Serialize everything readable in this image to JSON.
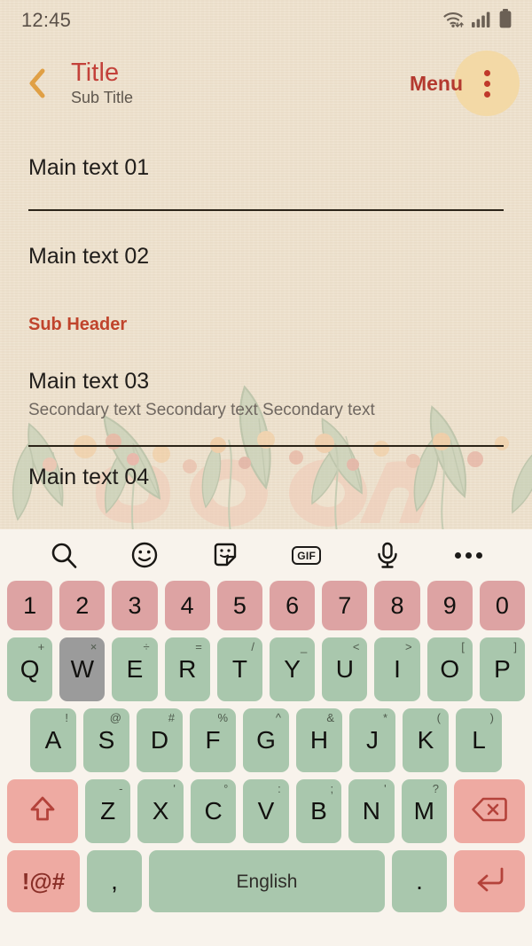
{
  "status_bar": {
    "time": "12:45",
    "icons": [
      "wifi-icon",
      "signal-icon",
      "battery-icon"
    ]
  },
  "app_bar": {
    "back_icon": "chevron-left-icon",
    "title": "Title",
    "subtitle": "Sub Title",
    "menu_label": "Menu",
    "overflow_icon": "more-vertical-icon",
    "accent_title_color": "#c3413a",
    "accent_menu_color": "#b4392f",
    "overflow_bg_color": "#f3d9a6"
  },
  "content": {
    "rows": [
      {
        "main": "Main text 01",
        "secondary": "",
        "divider_after": true
      },
      {
        "main": "Main text 02",
        "secondary": "",
        "divider_after": false
      }
    ],
    "sub_header": "Sub Header",
    "rows2": [
      {
        "main": "Main text 03",
        "secondary": "Secondary text Secondary text Secondary text",
        "divider_after": true
      },
      {
        "main": "Main text 04",
        "secondary": "",
        "divider_after": false
      }
    ],
    "sub_header_color": "#c0442c",
    "background_color": "#efe3d0"
  },
  "keyboard": {
    "toolbar": [
      {
        "name": "search-icon",
        "label": ""
      },
      {
        "name": "emoji-icon",
        "label": ""
      },
      {
        "name": "sticker-icon",
        "label": ""
      },
      {
        "name": "gif-icon",
        "label": "GIF"
      },
      {
        "name": "microphone-icon",
        "label": ""
      },
      {
        "name": "more-horizontal-icon",
        "label": ""
      }
    ],
    "number_row": [
      "1",
      "2",
      "3",
      "4",
      "5",
      "6",
      "7",
      "8",
      "9",
      "0"
    ],
    "row_q": [
      {
        "key": "Q",
        "sup": "+"
      },
      {
        "key": "W",
        "sup": "×",
        "pressed": true
      },
      {
        "key": "E",
        "sup": "÷"
      },
      {
        "key": "R",
        "sup": "="
      },
      {
        "key": "T",
        "sup": "/"
      },
      {
        "key": "Y",
        "sup": "_"
      },
      {
        "key": "U",
        "sup": "<"
      },
      {
        "key": "I",
        "sup": ">"
      },
      {
        "key": "O",
        "sup": "["
      },
      {
        "key": "P",
        "sup": "]"
      }
    ],
    "row_a": [
      {
        "key": "A",
        "sup": "!"
      },
      {
        "key": "S",
        "sup": "@"
      },
      {
        "key": "D",
        "sup": "#"
      },
      {
        "key": "F",
        "sup": "%"
      },
      {
        "key": "G",
        "sup": "^"
      },
      {
        "key": "H",
        "sup": "&"
      },
      {
        "key": "J",
        "sup": "*"
      },
      {
        "key": "K",
        "sup": "("
      },
      {
        "key": "L",
        "sup": ")"
      }
    ],
    "row_z": [
      {
        "key": "Z",
        "sup": "-"
      },
      {
        "key": "X",
        "sup": "'"
      },
      {
        "key": "C",
        "sup": "°"
      },
      {
        "key": "V",
        "sup": ":"
      },
      {
        "key": "B",
        "sup": ";"
      },
      {
        "key": "N",
        "sup": "'"
      },
      {
        "key": "M",
        "sup": "?"
      }
    ],
    "shift_icon": "shift-arrow-icon",
    "backspace_icon": "backspace-icon",
    "symbols_label": "!@#",
    "comma_label": ",",
    "space_label": "English",
    "period_label": ".",
    "enter_icon": "enter-arrow-icon",
    "colors": {
      "keyboard_bg": "#f8f3ec",
      "number_key": "#dda3a3",
      "letter_key": "#a9c7ad",
      "function_key": "#eeaaa2",
      "pressed_key": "#9b9b9b"
    }
  }
}
